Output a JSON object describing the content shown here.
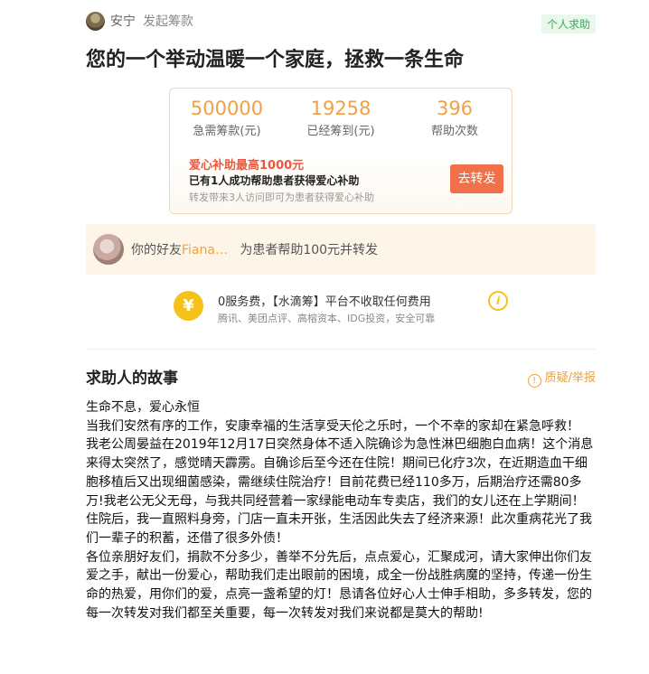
{
  "header": {
    "username": "安宁",
    "action": "发起筹款",
    "tag": "个人求助"
  },
  "title": "您的一个举动温暖一个家庭，拯救一条生命",
  "stats": [
    {
      "value": "500000",
      "label": "急需筹款(元)"
    },
    {
      "value": "19258",
      "label": "已经筹到(元)"
    },
    {
      "value": "396",
      "label": "帮助次数"
    }
  ],
  "subsidy": {
    "title": "爱心补助最高1000元",
    "line": "已有1人成功帮助患者获得爱心补助",
    "note": "转发带来3人访问即可为患者获得爱心补助",
    "button": "去转发"
  },
  "friend": {
    "prefix": "你的好友",
    "name": "Fiana…",
    "suffix": "为患者帮助100元并转发"
  },
  "fee": {
    "icon": "yen-icon",
    "symbol": "¥",
    "line": "0服务费，【水滴筹】平台不收取任何费用",
    "sub": "腾讯、美团点评、高榕资本、IDG投资，安全可靠",
    "info_symbol": "i"
  },
  "story": {
    "heading": "求助人的故事",
    "report": "质疑/举报",
    "paragraphs": [
      "生命不息，爱心永恒",
      "当我们安然有序的工作，安康幸福的生活享受天伦之乐时，一个不幸的家却在紧急呼救！",
      "我老公周晏益在2019年12月17日突然身体不适入院确诊为急性淋巴细胞白血病！这个消息来得太突然了，感觉晴天霹雳。自确诊后至今还在住院！期间已化疗3次，在近期造血干细胞移植后又出现细菌感染，需继续住院治疗！目前花费已经110多万，后期治疗还需80多万!我老公无父无母，与我共同经营着一家绿能电动车专卖店，我们的女儿还在上学期间！住院后，我一直照料身旁，门店一直未开张，生活因此失去了经济来源！此次重病花光了我们一辈子的积蓄，还借了很多外债！",
      "各位亲朋好友们，捐款不分多少，善举不分先后，点点爱心，汇聚成河，请大家伸出你们友爱之手，献出一份爱心，帮助我们走出眼前的困境，成全一份战胜病魔的坚持，传递一份生命的热爱，用你们的爱，点亮一盏希望的灯！恳请各位好心人士伸手相助，多多转发，您的每一次转发对我们都至关重要，每一次转发对我们来说都是莫大的帮助!"
    ]
  },
  "colors": {
    "accent": "#f0a048",
    "button": "#f0704a",
    "tag_green": "#3aa85a",
    "yen_yellow": "#f5c21b"
  }
}
